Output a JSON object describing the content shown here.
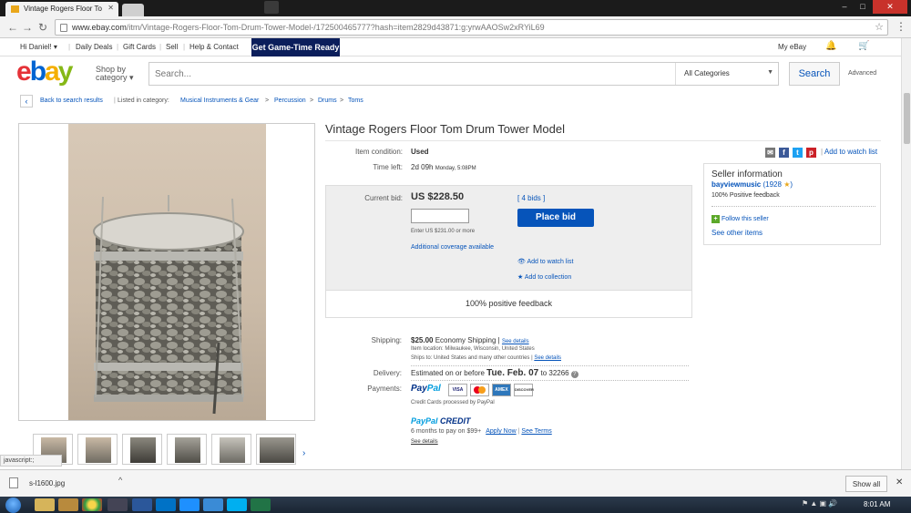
{
  "browser": {
    "tab_title": "Vintage Rogers Floor To",
    "url_main": "www.ebay.com",
    "url_path": "/itm/Vintage-Rogers-Floor-Tom-Drum-Tower-Model-/172500465777?hash=item2829d43871:g:yrwAAOSw2xRYiL69"
  },
  "ebay_top": {
    "greeting": "Hi Daniel!",
    "links": [
      "Daily Deals",
      "Gift Cards",
      "Sell",
      "Help & Contact"
    ],
    "promo": "Get Game-Time Ready",
    "my_ebay": "My eBay"
  },
  "header": {
    "shop_by": "Shop by",
    "category": "category",
    "search_placeholder": "Search...",
    "category_select": "All Categories",
    "search_button": "Search",
    "advanced": "Advanced"
  },
  "breadcrumb": {
    "back": "Back to search results",
    "listed_in": "Listed in category:",
    "items": [
      "Musical Instruments & Gear",
      "Percussion",
      "Drums",
      "Toms"
    ]
  },
  "item": {
    "title": "Vintage Rogers Floor Tom Drum Tower Model",
    "condition_label": "Item condition:",
    "condition_value": "Used",
    "time_left_label": "Time left:",
    "time_left_value": "2d 09h",
    "time_left_detail": "Monday, 5:08PM",
    "add_to_watch": "Add to watch list"
  },
  "bid": {
    "current_bid_label": "Current bid:",
    "current_bid_value": "US $228.50",
    "bids": "[ 4 bids ]",
    "enter_hint": "Enter US $231.00 or more",
    "place_bid": "Place bid",
    "coverage": "Additional coverage available",
    "watch": "Add to watch list",
    "collection": "Add to collection",
    "positive": "100% positive feedback"
  },
  "seller": {
    "heading": "Seller information",
    "name": "bayviewmusic",
    "score": "(1928",
    "score_end": ")",
    "feedback": "100% Positive feedback",
    "follow": "Follow this seller",
    "other": "See other items"
  },
  "shipping": {
    "label": "Shipping:",
    "price": "$25.00",
    "method": "Economy Shipping |",
    "details": "See details",
    "location": "Item location:  Milwaukee, Wisconsin, United States",
    "ships_to": "Ships to:  United States and many other countries |",
    "see_details": "See details"
  },
  "delivery": {
    "label": "Delivery:",
    "prefix": "Estimated on or before",
    "date": "Tue. Feb. 07",
    "to": "to 32266"
  },
  "payments": {
    "label": "Payments:",
    "paypal_a": "Pay",
    "paypal_b": "Pal",
    "cards": [
      "VISA",
      "MC",
      "AMEX",
      "DISCOVER"
    ],
    "processed": "Credit Cards processed by PayPal",
    "credit_a": "PayPal",
    "credit_b": "CREDIT",
    "credit_line": "6 months to pay on $99+",
    "apply": "Apply Now",
    "terms": "See Terms",
    "see_details": "See details"
  },
  "status_bubble": "javascript:;",
  "downloads": {
    "file": "s-l1600.jpg",
    "show_all": "Show all"
  },
  "taskbar": {
    "time": "8:01 AM"
  },
  "colors": {
    "ebay_blue": "#0654ba",
    "promo_navy": "#0b1e5b",
    "bid_box": "#eeeeee"
  }
}
